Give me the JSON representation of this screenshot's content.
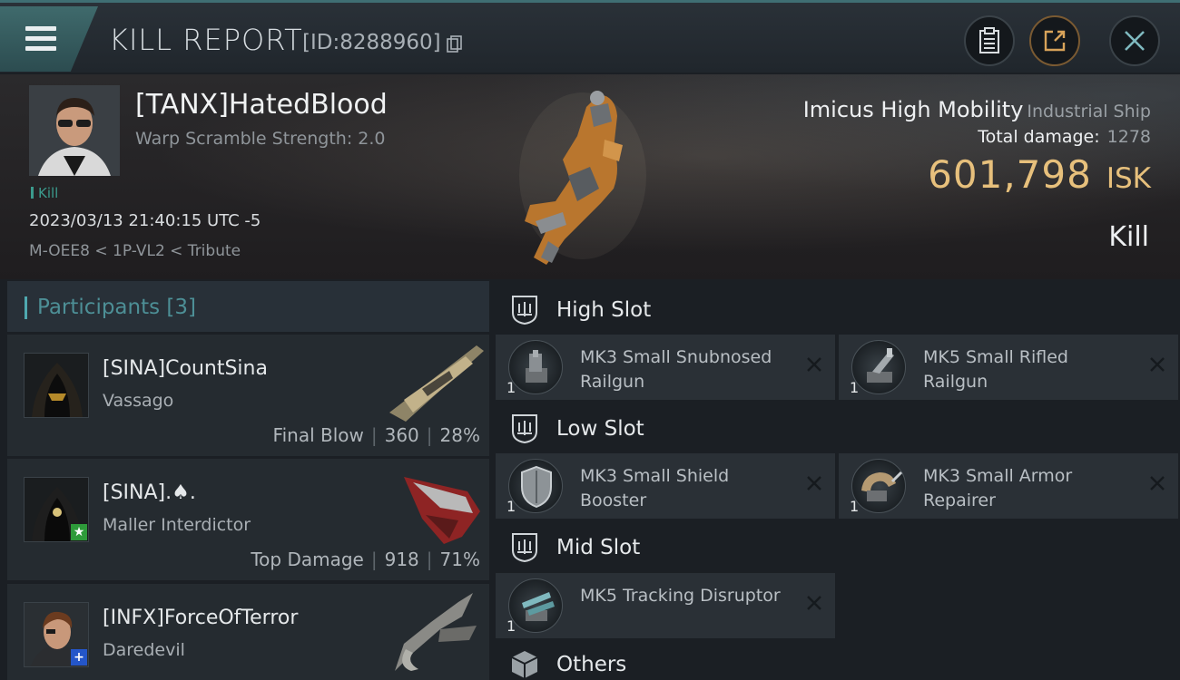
{
  "header": {
    "title": "KILL REPORT",
    "report_id": "[ID:8288960]",
    "icons": [
      "menu-icon",
      "copy-icon",
      "clipboard-icon",
      "share-icon",
      "close-icon"
    ]
  },
  "victim": {
    "name": "[TANX]HatedBlood",
    "warp_scramble": "Warp Scramble Strength: 2.0",
    "tag": "Kill",
    "datetime": "2023/03/13 21:40:15 UTC -5",
    "location": "M-OEE8 < 1P-VL2 < Tribute",
    "ship_name": "Imicus High Mobility",
    "ship_class": "Industrial Ship",
    "total_damage_label": "Total damage:",
    "total_damage": "1278",
    "isk_value": "601,798",
    "isk_unit": "ISK",
    "outcome": "Kill"
  },
  "participants": {
    "label": "Participants [3]",
    "items": [
      {
        "name": "[SINA]CountSina",
        "ship": "Vassago",
        "role": "Final Blow",
        "damage": "360",
        "percent": "28%",
        "badge": ""
      },
      {
        "name": "[SINA].♠.",
        "ship": "Maller Interdictor",
        "role": "Top Damage",
        "damage": "918",
        "percent": "71%",
        "badge": "★"
      },
      {
        "name": "[INFX]ForceOfTerror",
        "ship": "Daredevil",
        "role": "",
        "damage": "",
        "percent": "",
        "badge": "+"
      }
    ]
  },
  "slots": {
    "high": {
      "label": "High Slot",
      "modules": [
        {
          "name": "MK3 Small Snubnosed Railgun",
          "qty": "1"
        },
        {
          "name": "MK5 Small Rifled Railgun",
          "qty": "1"
        }
      ]
    },
    "low": {
      "label": "Low Slot",
      "modules": [
        {
          "name": "MK3 Small Shield Booster",
          "qty": "1"
        },
        {
          "name": "MK3 Small Armor Repairer",
          "qty": "1"
        }
      ]
    },
    "mid": {
      "label": "Mid Slot",
      "modules": [
        {
          "name": "MK5 Tracking Disruptor",
          "qty": "1"
        }
      ]
    },
    "others": {
      "label": "Others"
    }
  },
  "colors": {
    "accent_teal": "#4fa9b0",
    "isk_gold": "#e7c07c",
    "badge_green": "#2e9b3a",
    "badge_blue": "#2456c9"
  }
}
